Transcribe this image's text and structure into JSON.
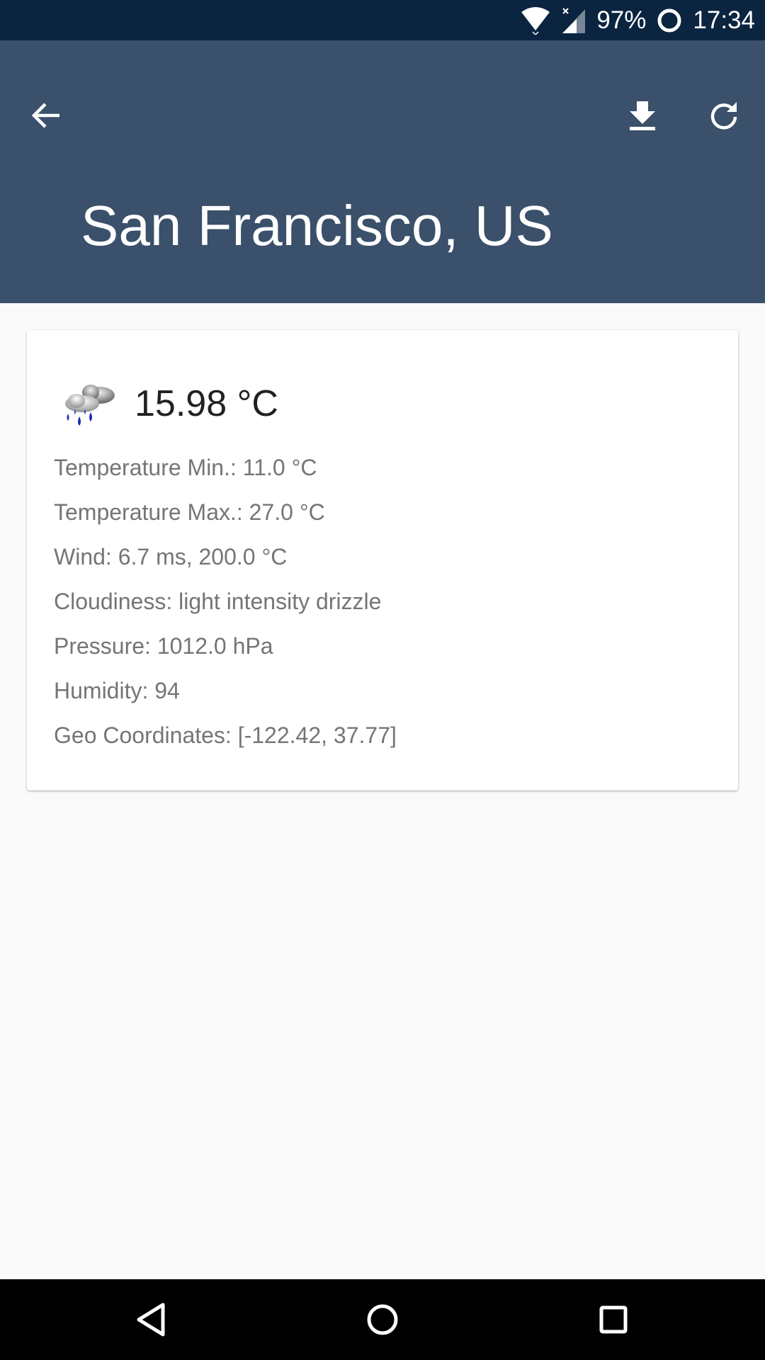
{
  "status_bar": {
    "battery": "97%",
    "time": "17:34",
    "icons": [
      "wifi-icon",
      "signal-icon",
      "battery-icon"
    ]
  },
  "app_bar": {
    "title": "San Francisco, US",
    "background_color": "#3a506b",
    "icons": [
      "arrow-back-icon",
      "download-icon",
      "refresh-icon"
    ]
  },
  "weather": {
    "icon": "rain-cloud-icon",
    "temperature": "15.98 °C",
    "details": {
      "temp_min": "Temperature Min.: 11.0 °C",
      "temp_max": "Temperature Max.: 27.0 °C",
      "wind": "Wind: 6.7 ms, 200.0 °C",
      "cloudiness": "Cloudiness: light intensity drizzle",
      "pressure": "Pressure: 1012.0 hPa",
      "humidity": "Humidity: 94",
      "geo": "Geo Coordinates: [-122.42, 37.77]"
    }
  },
  "nav_bar": {
    "icons": [
      "nav-back-icon",
      "nav-home-icon",
      "nav-recents-icon"
    ]
  }
}
